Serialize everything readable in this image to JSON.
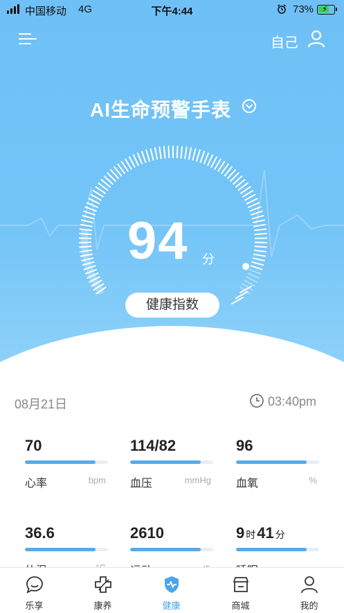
{
  "statusbar": {
    "carrier": "中国移动",
    "network": "4G",
    "time": "下午4:44",
    "battery": "73%",
    "battery_level": 0.73
  },
  "header": {
    "self_label": "自己"
  },
  "device": {
    "title": "AI生命预警手表"
  },
  "score": {
    "value": "94",
    "unit": "分",
    "label": "健康指数",
    "fraction": 0.94
  },
  "summary": {
    "date": "08月21日",
    "time": "03:40pm"
  },
  "metrics": [
    {
      "value": "70",
      "name": "心率",
      "unit": "bpm",
      "progress": 0.85
    },
    {
      "value": "114/82",
      "name": "血压",
      "unit": "mmHg",
      "progress": 0.85
    },
    {
      "value": "96",
      "name": "血氧",
      "unit": "%",
      "progress": 0.85
    },
    {
      "value": "36.6",
      "name": "体温",
      "unit": "°C",
      "progress": 0.85
    },
    {
      "value": "2610",
      "name": "运动",
      "unit": "步",
      "progress": 0.85
    },
    {
      "v1": "9",
      "u1": "时",
      "v2": "41",
      "u2": "分",
      "name": "睡眠",
      "unit": "",
      "progress": 0.85
    }
  ],
  "tabs": [
    {
      "label": "乐享",
      "icon": "chat-bubble-icon"
    },
    {
      "label": "康养",
      "icon": "leaf-cross-icon"
    },
    {
      "label": "健康",
      "icon": "shield-pulse-icon",
      "active": true
    },
    {
      "label": "商城",
      "icon": "store-icon"
    },
    {
      "label": "我的",
      "icon": "person-icon"
    }
  ],
  "colors": {
    "hero": "#73c4f7",
    "accent": "#4aa5ea",
    "bar": "#5aa9e6"
  }
}
